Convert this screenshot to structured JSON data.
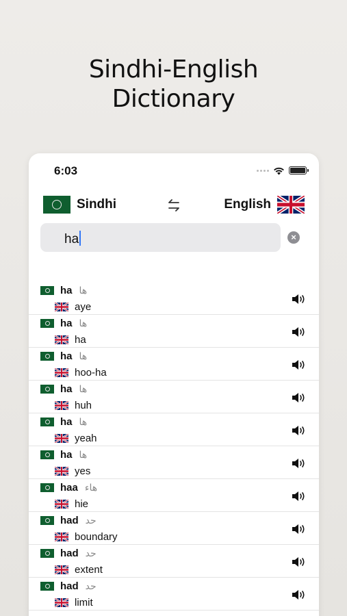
{
  "headline": {
    "line1": "Sindhi-English",
    "line2": "Dictionary"
  },
  "status_bar": {
    "time": "6:03"
  },
  "languages": {
    "source": "Sindhi",
    "target": "English"
  },
  "search": {
    "value": "ha"
  },
  "icons": {
    "swap": "swap-arrows-icon",
    "clear": "clear-circle-icon",
    "speaker": "speaker-icon",
    "source_flag": "pakistan-flag-icon",
    "target_flag": "uk-flag-icon"
  },
  "colors": {
    "flag_green": "#0f5e2f",
    "caret": "#3478f6",
    "search_bg": "#e9e9eb"
  },
  "results": [
    {
      "word": "ha",
      "script": "ها",
      "translation": "aye"
    },
    {
      "word": "ha",
      "script": "ها",
      "translation": "ha"
    },
    {
      "word": "ha",
      "script": "ها",
      "translation": "hoo-ha"
    },
    {
      "word": "ha",
      "script": "ها",
      "translation": "huh"
    },
    {
      "word": "ha",
      "script": "ها",
      "translation": "yeah"
    },
    {
      "word": "ha",
      "script": "ها",
      "translation": "yes"
    },
    {
      "word": "haa",
      "script": "هاء",
      "translation": "hie"
    },
    {
      "word": "had",
      "script": "حد",
      "translation": "boundary"
    },
    {
      "word": "had",
      "script": "حد",
      "translation": "extent"
    },
    {
      "word": "had",
      "script": "حد",
      "translation": "limit"
    }
  ]
}
